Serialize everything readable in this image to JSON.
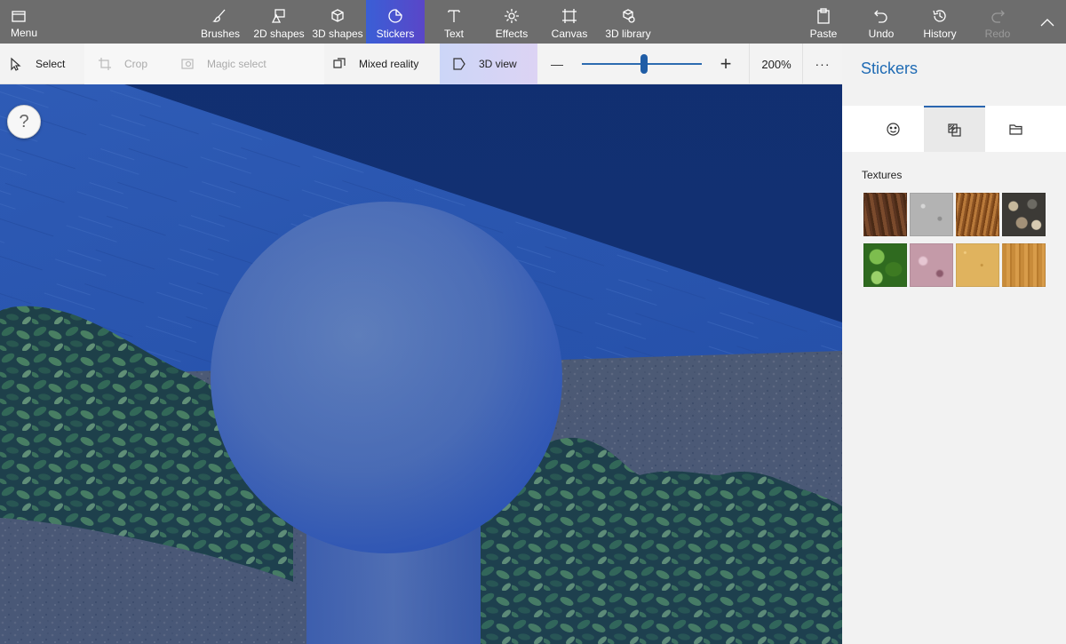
{
  "ribbon": {
    "menu_label": "Menu",
    "tools": [
      {
        "label": "Brushes"
      },
      {
        "label": "2D shapes"
      },
      {
        "label": "3D shapes"
      },
      {
        "label": "Stickers"
      },
      {
        "label": "Text"
      },
      {
        "label": "Effects"
      },
      {
        "label": "Canvas"
      },
      {
        "label": "3D library"
      }
    ],
    "active_tool": "Stickers",
    "actions": [
      {
        "label": "Paste"
      },
      {
        "label": "Undo"
      },
      {
        "label": "History"
      },
      {
        "label": "Redo",
        "disabled": true
      }
    ],
    "collapse_icon": "chevron-up-icon",
    "active_color": "#4a55d0"
  },
  "toolbar": {
    "select_label": "Select",
    "crop_label": "Crop",
    "magic_select_label": "Magic select",
    "mixed_reality_label": "Mixed reality",
    "view_3d_label": "3D view",
    "zoom_out_symbol": "—",
    "zoom_in_symbol": "+",
    "zoom_level": "200%",
    "zoom_fraction": 0.52,
    "more_symbol": "···"
  },
  "canvas": {
    "help_symbol": "?"
  },
  "panel": {
    "title": "Stickers",
    "tabs": [
      {
        "icon": "sticker-icon"
      },
      {
        "icon": "textures-icon",
        "active": true
      },
      {
        "icon": "folder-icon"
      }
    ],
    "section_label": "Textures",
    "textures": [
      {
        "name": "bark",
        "color": "#6b3e25"
      },
      {
        "name": "stone",
        "color": "#b3b3b3"
      },
      {
        "name": "hair",
        "color": "#9a5a22"
      },
      {
        "name": "pebbles",
        "color": "#8f8470"
      },
      {
        "name": "leaves",
        "color": "#4e8a2a"
      },
      {
        "name": "marble",
        "color": "#c49aa8"
      },
      {
        "name": "sand",
        "color": "#e0b35e"
      },
      {
        "name": "wood",
        "color": "#c88b3a"
      }
    ]
  }
}
